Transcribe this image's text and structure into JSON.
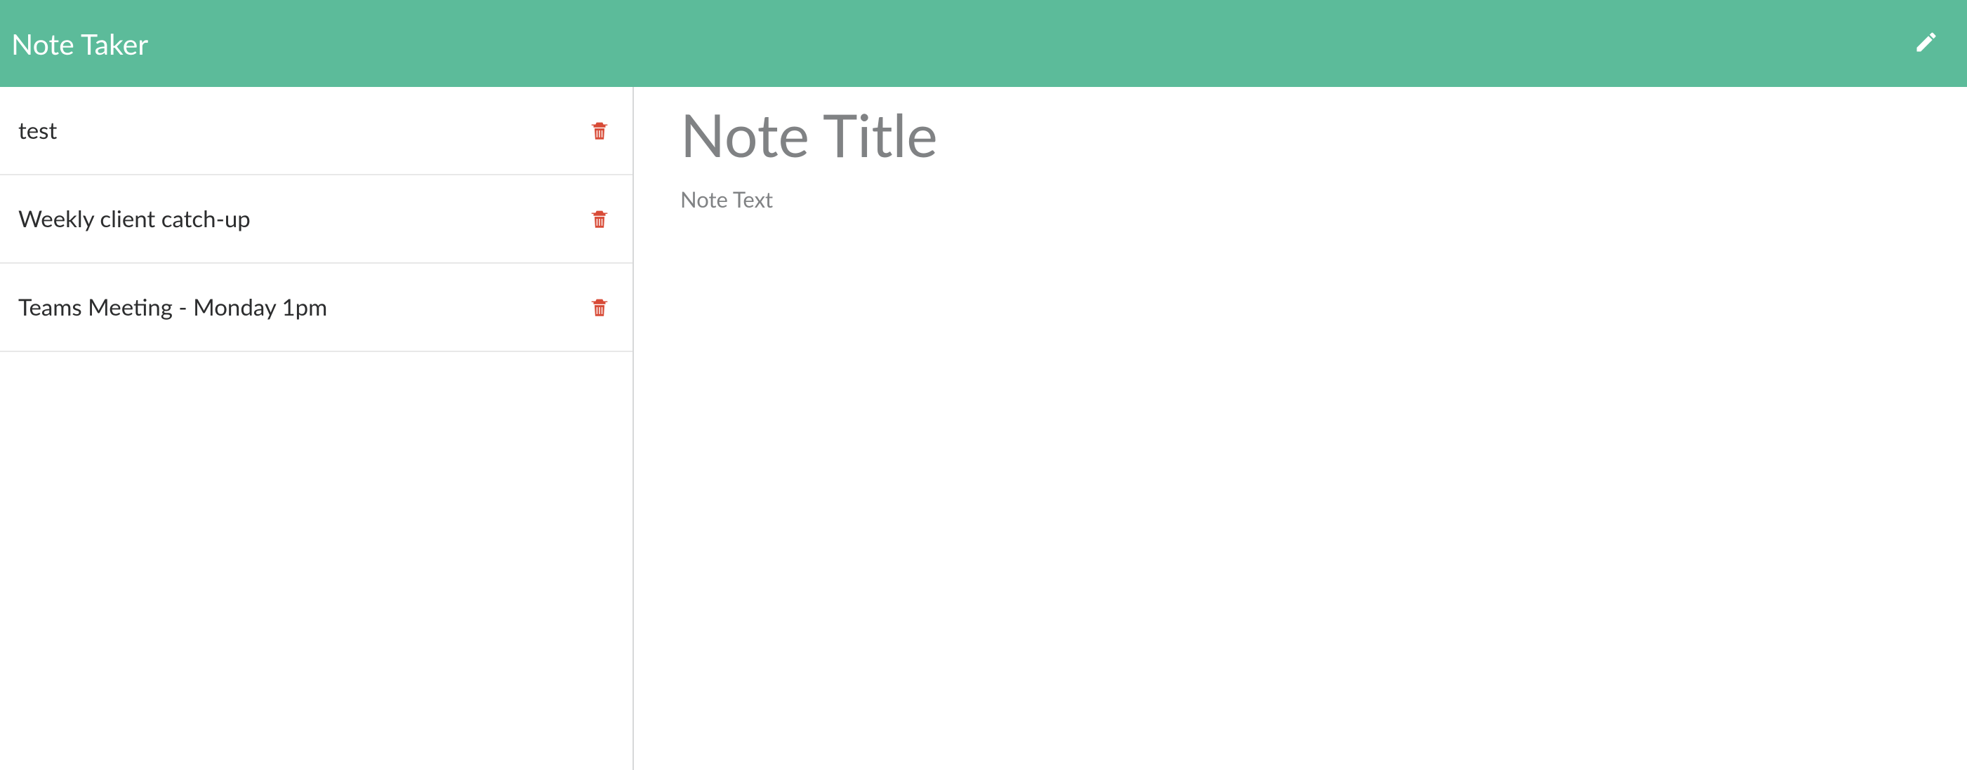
{
  "header": {
    "title": "Note Taker"
  },
  "sidebar": {
    "notes": [
      {
        "title": "test"
      },
      {
        "title": "Weekly client catch-up"
      },
      {
        "title": "Teams Meeting - Monday 1pm"
      }
    ]
  },
  "editor": {
    "title_placeholder": "Note Title",
    "text_placeholder": "Note Text",
    "title_value": "",
    "text_value": ""
  },
  "colors": {
    "header_bg": "#5cbb9a",
    "trash": "#d84b37"
  }
}
